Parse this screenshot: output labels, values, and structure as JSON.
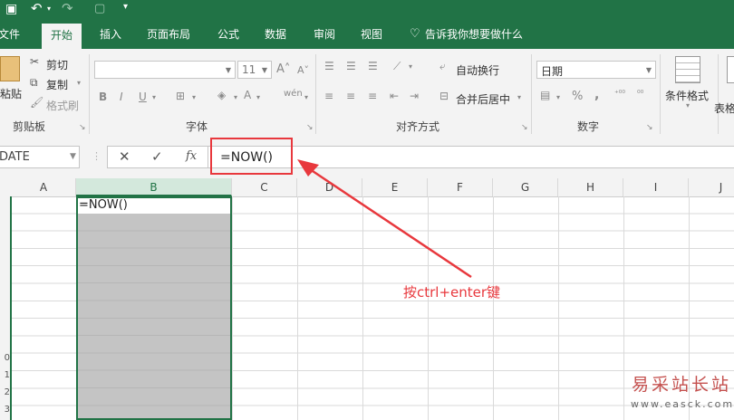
{
  "tabs": [
    "文件",
    "开始",
    "插入",
    "页面布局",
    "公式",
    "数据",
    "审阅",
    "视图"
  ],
  "tell_me": "告诉我你想要做什么",
  "ribbon": {
    "clipboard": {
      "paste": "粘贴",
      "cut": "剪切",
      "copy": "复制",
      "format_painter": "格式刷",
      "label": "剪贴板"
    },
    "font": {
      "font_name": "",
      "font_size": "11",
      "bold": "B",
      "italic": "I",
      "underline": "U",
      "label": "字体"
    },
    "alignment": {
      "wrap_text": "自动换行",
      "merge_center": "合并后居中",
      "label": "对齐方式"
    },
    "number": {
      "format": "日期",
      "percent": "%",
      "comma": ",",
      "label": "数字"
    },
    "styles": {
      "conditional": "条件格式",
      "table_partial": "表格"
    }
  },
  "formula_bar": {
    "name_box": "DATE",
    "cancel": "✕",
    "enter": "✓",
    "fx": "fx",
    "formula": "=NOW()"
  },
  "columns": [
    "A",
    "B",
    "C",
    "D",
    "E",
    "F",
    "G",
    "H",
    "I",
    "J"
  ],
  "selected_column": "B",
  "rows": [
    "",
    "",
    "",
    "",
    "",
    "",
    "",
    "",
    "",
    "0",
    "1",
    "2",
    "3"
  ],
  "active_cell_value": "=NOW()",
  "annotation": "按ctrl+enter键",
  "watermark": {
    "text": "易采站长站",
    "url": "www.easck.com"
  },
  "colors": {
    "accent": "#217346",
    "annotation": "#e8383d",
    "selection_fill": "#c4c4c4"
  }
}
